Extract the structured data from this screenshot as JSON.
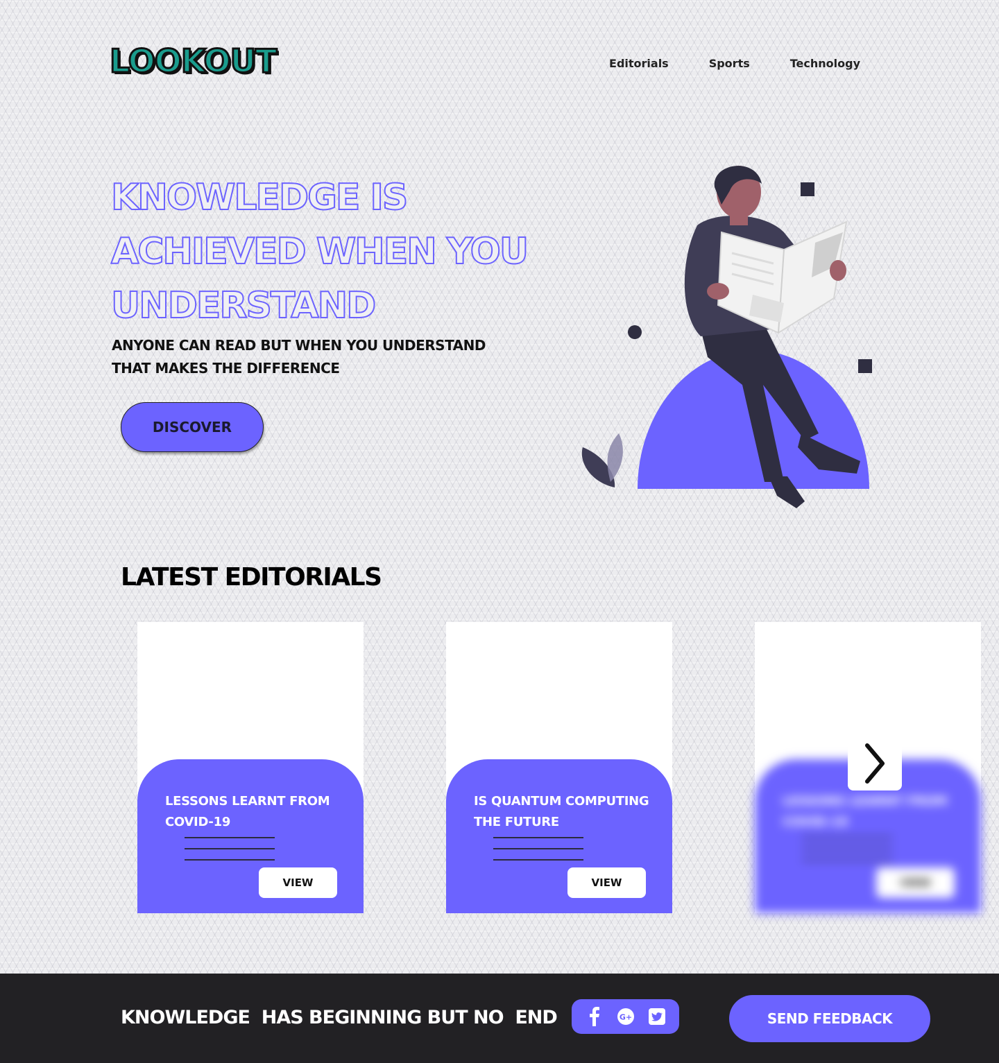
{
  "header": {
    "logo": "LOOKOUT",
    "nav": [
      "Editorials",
      "Sports",
      "Technology"
    ]
  },
  "hero": {
    "title": "KNOWLEDGE IS ACHIEVED WHEN YOU UNDERSTAND",
    "subtitle": "ANYONE CAN READ BUT WHEN YOU UNDERSTAND THAT MAKES THE DIFFERENCE",
    "cta_label": "DISCOVER"
  },
  "editorials": {
    "title": "LATEST EDITORIALS",
    "cards": [
      {
        "title": "LESSONS LEARNT  FROM COVID-19",
        "button": "VIEW"
      },
      {
        "title": "IS QUANTUM COMPUTING THE FUTURE",
        "button": "VIEW"
      },
      {
        "title": "LESSONS LEARNT  FROM COVID-19",
        "button": "VIEW"
      }
    ]
  },
  "footer": {
    "tagline": "KNOWLEDGE  HAS BEGINNING BUT NO  END",
    "social_icons": [
      "facebook-icon",
      "google-plus-icon",
      "twitter-icon"
    ],
    "feedback_label": "SEND FEEDBACK"
  },
  "colors": {
    "accent": "#6c63ff",
    "logo_fill": "#1a9c8d",
    "footer_bg": "#222124",
    "dark": "#2f2e41"
  }
}
